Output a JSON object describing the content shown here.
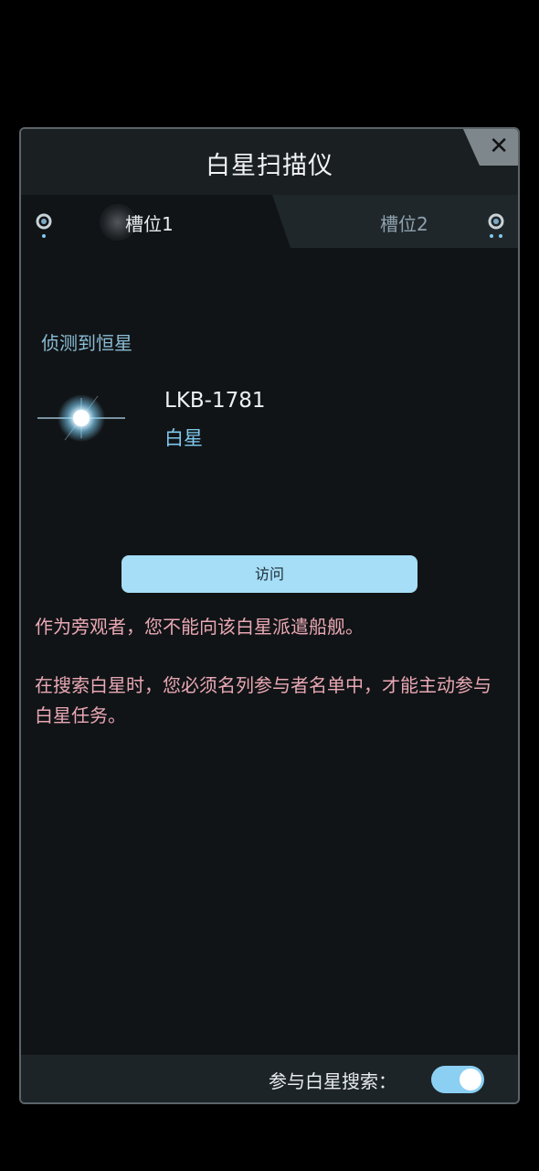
{
  "dialog": {
    "title": "白星扫描仪",
    "close_icon": "close-icon"
  },
  "tabs": [
    {
      "label": "槽位1",
      "selected": true
    },
    {
      "label": "槽位2",
      "selected": false
    }
  ],
  "detected": {
    "section_label": "侦测到恒星",
    "star_name": "LKB-1781",
    "star_type": "白星",
    "star_icon": "white-star-icon"
  },
  "visit_button": {
    "label": "访问"
  },
  "warnings": [
    "作为旁观者，您不能向该白星派遣船舰。",
    "在搜索白星时，您必须名列参与者名单中，才能主动参与白星任务。"
  ],
  "footer": {
    "label": "参与白星搜索：",
    "toggle_on": true
  },
  "colors": {
    "accent": "#a6def8",
    "warning_text": "#e9a8b5",
    "section_text": "#8bbdd6"
  }
}
